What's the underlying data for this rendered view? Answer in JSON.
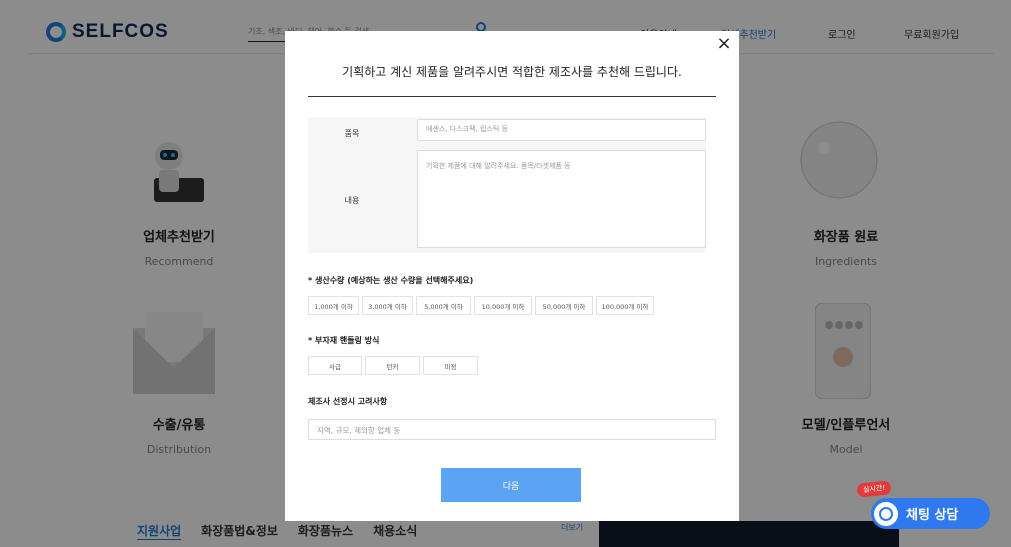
{
  "header": {
    "logo_text": "SELFCOS",
    "search_placeholder": "기초, 색조, 바디, 헤어, 향수 등 검색",
    "nav": [
      "이용안내",
      "업체추천받기",
      "로그인",
      "무료회원가입"
    ]
  },
  "features": [
    {
      "title": "업체추천받기",
      "sub": "Recommend"
    },
    {
      "title": "화장품 원료",
      "sub": "Ingredients"
    },
    {
      "title": "수출/유통",
      "sub": "Distribution"
    },
    {
      "title": "모델/인플루언서",
      "sub": "Model"
    }
  ],
  "bottom_tabs": [
    "지원사업",
    "화장품법&정보",
    "화장품뉴스",
    "채용소식"
  ],
  "more_label": "더보기",
  "modal": {
    "close": "×",
    "title": "기획하고 계신 제품을 알려주시면 적합한 제조사를 추천해 드립니다.",
    "item_label": "품목",
    "item_placeholder": "에센스, 다스크팩, 립스틱 등",
    "content_label": "내용",
    "content_placeholder": "기획한 제품에 대해 알려주세요. 품목/타겟제품 등",
    "quantity_label": "* 생산수량 (예상하는 생산 수량을 선택해주세요)",
    "quantity_options": [
      "1,000개 이하",
      "3,000개 이하",
      "5,000개 이하",
      "10,000개 이하",
      "50,000개 이하",
      "100,000개 이하"
    ],
    "material_label": "* 부자재 핸들링 방식",
    "material_options": [
      "사급",
      "턴키",
      "미정"
    ],
    "consider_label": "제조사 선정시 고려사항",
    "consider_placeholder": "지역, 규모, 제의항 업체 등",
    "next_label": "다음"
  },
  "chat": {
    "badge": "실시간!",
    "label": "채팅 상담"
  },
  "colors": {
    "accent": "#1f7bd6",
    "next_button": "#5aa3f5",
    "chat_button": "#2f79f0"
  }
}
